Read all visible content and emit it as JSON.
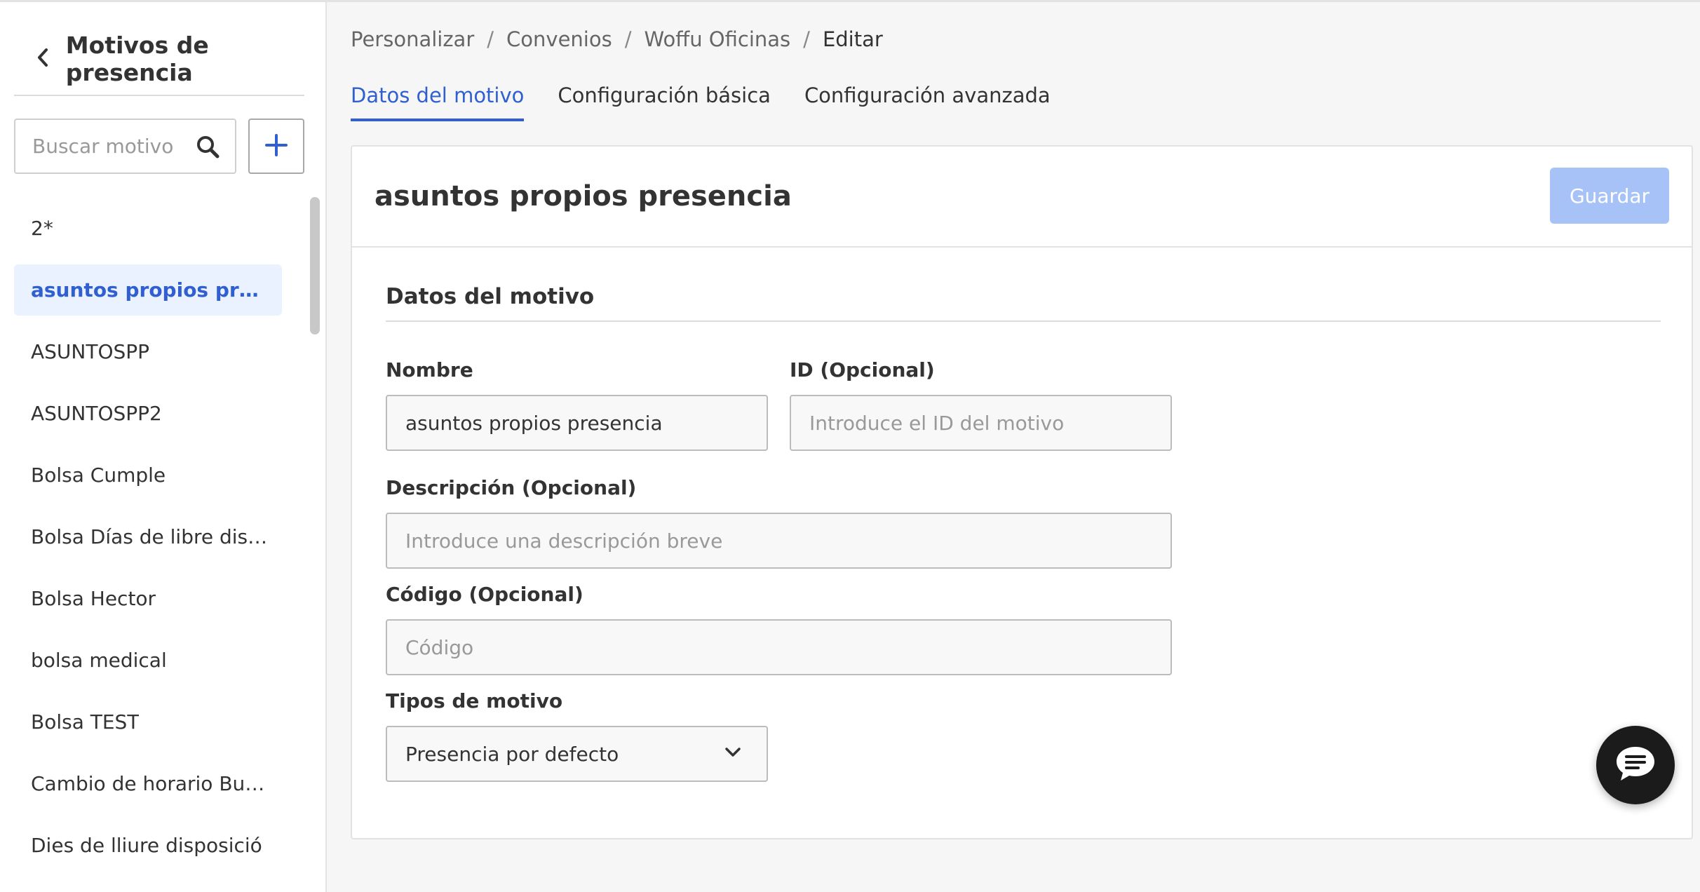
{
  "sidebar": {
    "title": "Motivos de presencia",
    "search_placeholder": "Buscar motivo",
    "items": [
      {
        "label": "2*"
      },
      {
        "label": "asuntos propios presenc..."
      },
      {
        "label": "ASUNTOSPP"
      },
      {
        "label": "ASUNTOSPP2"
      },
      {
        "label": "Bolsa Cumple"
      },
      {
        "label": "Bolsa Días de libre disp..."
      },
      {
        "label": "Bolsa Hector"
      },
      {
        "label": "bolsa medical"
      },
      {
        "label": "Bolsa TEST"
      },
      {
        "label": "Cambio de horario Bug 4..."
      },
      {
        "label": "Dies de lliure disposició"
      }
    ],
    "active_index": 1
  },
  "breadcrumb": {
    "items": [
      "Personalizar",
      "Convenios",
      "Woffu Oficinas"
    ],
    "current": "Editar",
    "separator": "/"
  },
  "tabs": [
    {
      "label": "Datos del motivo",
      "active": true
    },
    {
      "label": "Configuración básica",
      "active": false
    },
    {
      "label": "Configuración avanzada",
      "active": false
    }
  ],
  "card": {
    "title": "asuntos propios presencia",
    "save_label": "Guardar",
    "section_title": "Datos del motivo"
  },
  "form": {
    "name": {
      "label": "Nombre",
      "value": "asuntos propios presencia"
    },
    "id": {
      "label": "ID (Opcional)",
      "value": "",
      "placeholder": "Introduce el ID del motivo"
    },
    "description": {
      "label": "Descripción (Opcional)",
      "value": "",
      "placeholder": "Introduce una descripción breve"
    },
    "code": {
      "label": "Código (Opcional)",
      "value": "",
      "placeholder": "Código"
    },
    "type": {
      "label": "Tipos de motivo",
      "selected": "Presencia por defecto"
    }
  },
  "icons": {
    "back": "chevron-left-icon",
    "search": "search-icon",
    "add": "plus-icon",
    "dropdown": "chevron-down-icon",
    "chat": "chat-bubble-icon"
  },
  "colors": {
    "accent": "#2f5fd0",
    "active_item_bg": "#ebf2ff",
    "save_disabled": "#a7c2f7",
    "chat_bg": "#1b1b1b"
  }
}
